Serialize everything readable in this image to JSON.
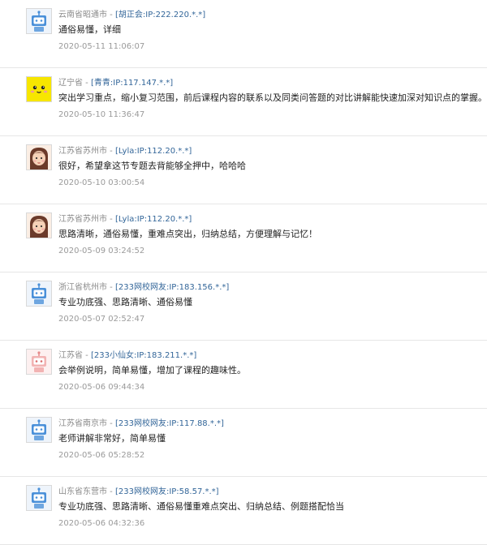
{
  "comments": [
    {
      "avatar": "robot-icon",
      "location": "云南省昭通市",
      "separator": " - ",
      "user": "[胡正会:IP:222.220.*.*]",
      "text": "通俗易懂，详细",
      "time": "2020-05-11 11:06:07"
    },
    {
      "avatar": "yellow-face-icon",
      "location": "辽宁省",
      "separator": " - ",
      "user": "[青青:IP:117.147.*.*]",
      "text": "突出学习重点，缩小复习范围，前后课程内容的联系以及同类问答题的对比讲解能快速加深对知识点的掌握。",
      "time": "2020-05-10 11:36:47"
    },
    {
      "avatar": "girl-face-icon",
      "location": "江苏省苏州市",
      "separator": " - ",
      "user": "[Lyla:IP:112.20.*.*]",
      "text": "很好，希望拿这节专题去背能够全押中，哈哈哈",
      "time": "2020-05-10 03:00:54"
    },
    {
      "avatar": "girl-face-icon",
      "location": "江苏省苏州市",
      "separator": " - ",
      "user": "[Lyla:IP:112.20.*.*]",
      "text": "思路清晰，通俗易懂，重难点突出，归纳总结，方便理解与记忆！",
      "time": "2020-05-09 03:24:52"
    },
    {
      "avatar": "robot-icon",
      "location": "浙江省杭州市",
      "separator": " - ",
      "user": "[233网校网友:IP:183.156.*.*]",
      "text": "专业功底强、思路清晰、通俗易懂",
      "time": "2020-05-07 02:52:47"
    },
    {
      "avatar": "pink-robot-icon",
      "location": "江苏省",
      "separator": " - ",
      "user": "[233小仙女:IP:183.211.*.*]",
      "text": "会举例说明，简单易懂，增加了课程的趣味性。",
      "time": "2020-05-06 09:44:34"
    },
    {
      "avatar": "robot-icon",
      "location": "江苏省南京市",
      "separator": " - ",
      "user": "[233网校网友:IP:117.88.*.*]",
      "text": "老师讲解非常好，简单易懂",
      "time": "2020-05-06 05:28:52"
    },
    {
      "avatar": "robot-icon",
      "location": "山东省东营市",
      "separator": " - ",
      "user": "[233网校网友:IP:58.57.*.*]",
      "text": "专业功底强、思路清晰、通俗易懂重难点突出、归纳总结、例题搭配恰当",
      "time": "2020-05-06 04:32:36"
    }
  ],
  "colors": {
    "link": "#336699",
    "meta": "#8a8a8a",
    "divider": "#e6e6e6"
  }
}
